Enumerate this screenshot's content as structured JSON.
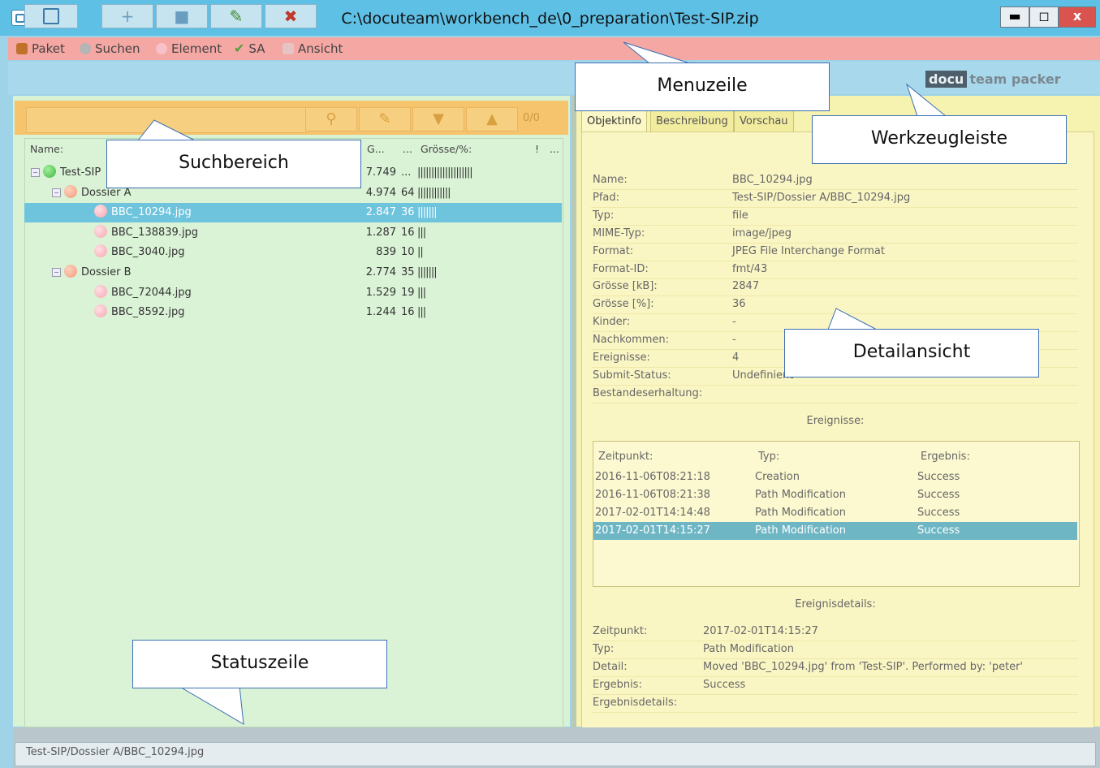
{
  "window": {
    "title": "C:\\docuteam\\workbench_de\\0_preparation\\Test-SIP.zip",
    "controls": [
      "▬",
      "◻",
      "x"
    ]
  },
  "menu": [
    {
      "label": "Paket",
      "icon": "package-icon",
      "color": "#c0722a"
    },
    {
      "label": "Suchen",
      "icon": "magnifier-icon",
      "color": "#8e8e8e"
    },
    {
      "label": "Element",
      "icon": "element-ball-icon",
      "color": "#f3a7b2"
    },
    {
      "label": "SA",
      "icon": "checkmark-icon",
      "color": "#5c9d3c"
    },
    {
      "label": "Ansicht",
      "icon": "view-icon",
      "color": "#d0b0b0"
    }
  ],
  "toolbar": {
    "buttons": [
      {
        "name": "save-button",
        "icon": "save-icon",
        "glyph": "💾"
      },
      {
        "name": "add-button",
        "icon": "plus-icon",
        "glyph": "+"
      },
      {
        "name": "folder-button",
        "icon": "folder-icon",
        "glyph": "■"
      },
      {
        "name": "edit-button",
        "icon": "pencil-icon",
        "glyph": "✎"
      },
      {
        "name": "delete-button",
        "icon": "delete-x-icon",
        "glyph": "✖"
      }
    ],
    "brand_a": "docu",
    "brand_b": "team packer"
  },
  "search": {
    "value": "",
    "match_count": "0/0"
  },
  "tree": {
    "headers": {
      "name": "Name:",
      "g": "G...",
      "dots": "...",
      "size": "Grösse/%:",
      "excl": "!",
      "more": "..."
    },
    "rows": [
      {
        "label": "Test-SIP",
        "indent": 0,
        "ball": "g",
        "expander": "⊟",
        "size": "7.749",
        "pct": "...",
        "bars": "||||||||||||||||||||"
      },
      {
        "label": "Dossier A",
        "indent": 1,
        "ball": "o",
        "expander": "⊟",
        "size": "4.974",
        "pct": "64",
        "bars": "||||||||||||"
      },
      {
        "label": "BBC_10294.jpg",
        "indent": 2,
        "ball": "p",
        "expander": "",
        "size": "2.847",
        "pct": "36",
        "bars": "|||||||",
        "selected": true
      },
      {
        "label": "BBC_138839.jpg",
        "indent": 2,
        "ball": "p",
        "expander": "",
        "size": "1.287",
        "pct": "16",
        "bars": "|||"
      },
      {
        "label": "BBC_3040.jpg",
        "indent": 2,
        "ball": "p",
        "expander": "",
        "size": "839",
        "pct": "10",
        "bars": "||"
      },
      {
        "label": "Dossier B",
        "indent": 1,
        "ball": "o",
        "expander": "⊟",
        "size": "2.774",
        "pct": "35",
        "bars": "|||||||"
      },
      {
        "label": "BBC_72044.jpg",
        "indent": 2,
        "ball": "p",
        "expander": "",
        "size": "1.529",
        "pct": "19",
        "bars": "|||"
      },
      {
        "label": "BBC_8592.jpg",
        "indent": 2,
        "ball": "p",
        "expander": "",
        "size": "1.244",
        "pct": "16",
        "bars": "|||"
      }
    ]
  },
  "tabs": [
    {
      "label": "Objektinfo",
      "active": true
    },
    {
      "label": "Beschreibung",
      "active": false
    },
    {
      "label": "Vorschau",
      "active": false
    }
  ],
  "details": [
    {
      "key": "Name:",
      "value": "BBC_10294.jpg"
    },
    {
      "key": "Pfad:",
      "value": "Test-SIP/Dossier A/BBC_10294.jpg"
    },
    {
      "key": "Typ:",
      "value": "file"
    },
    {
      "key": "MIME-Typ:",
      "value": "image/jpeg"
    },
    {
      "key": "Format:",
      "value": "JPEG File Interchange Format"
    },
    {
      "key": "Format-ID:",
      "value": "fmt/43"
    },
    {
      "key": "Grösse [kB]:",
      "value": "2847"
    },
    {
      "key": "Grösse [%]:",
      "value": "36"
    },
    {
      "key": "Kinder:",
      "value": "-"
    },
    {
      "key": "Nachkommen:",
      "value": "-"
    },
    {
      "key": "Ereignisse:",
      "value": "4"
    },
    {
      "key": "Submit-Status:",
      "value": "Undefinient"
    },
    {
      "key": "Bestandeserhaltung:",
      "value": ""
    }
  ],
  "events": {
    "title": "Ereignisse:",
    "headers": [
      "Zeitpunkt:",
      "Typ:",
      "Ergebnis:"
    ],
    "rows": [
      {
        "time": "2016-11-06T08:21:18",
        "type": "Creation",
        "result": "Success"
      },
      {
        "time": "2016-11-06T08:21:38",
        "type": "Path Modification",
        "result": "Success"
      },
      {
        "time": "2017-02-01T14:14:48",
        "type": "Path Modification",
        "result": "Success"
      },
      {
        "time": "2017-02-01T14:15:27",
        "type": "Path Modification",
        "result": "Success",
        "selected": true
      }
    ]
  },
  "event_details": {
    "title": "Ereignisdetails:",
    "rows": [
      {
        "key": "Zeitpunkt:",
        "value": "2017-02-01T14:15:27"
      },
      {
        "key": "Typ:",
        "value": "Path Modification"
      },
      {
        "key": "Detail:",
        "value": "Moved 'BBC_10294.jpg' from 'Test-SIP'. Performed by: 'peter'"
      },
      {
        "key": "Ergebnis:",
        "value": "Success"
      },
      {
        "key": "Ergebnisdetails:",
        "value": ""
      }
    ]
  },
  "status": {
    "text": "Test-SIP/Dossier A/BBC_10294.jpg"
  },
  "callouts": {
    "menuzeile": "Menuzeile",
    "werkzeugleiste": "Werkzeugleiste",
    "suchbereich": "Suchbereich",
    "detailansicht": "Detailansicht",
    "statuszeile": "Statuszeile"
  }
}
